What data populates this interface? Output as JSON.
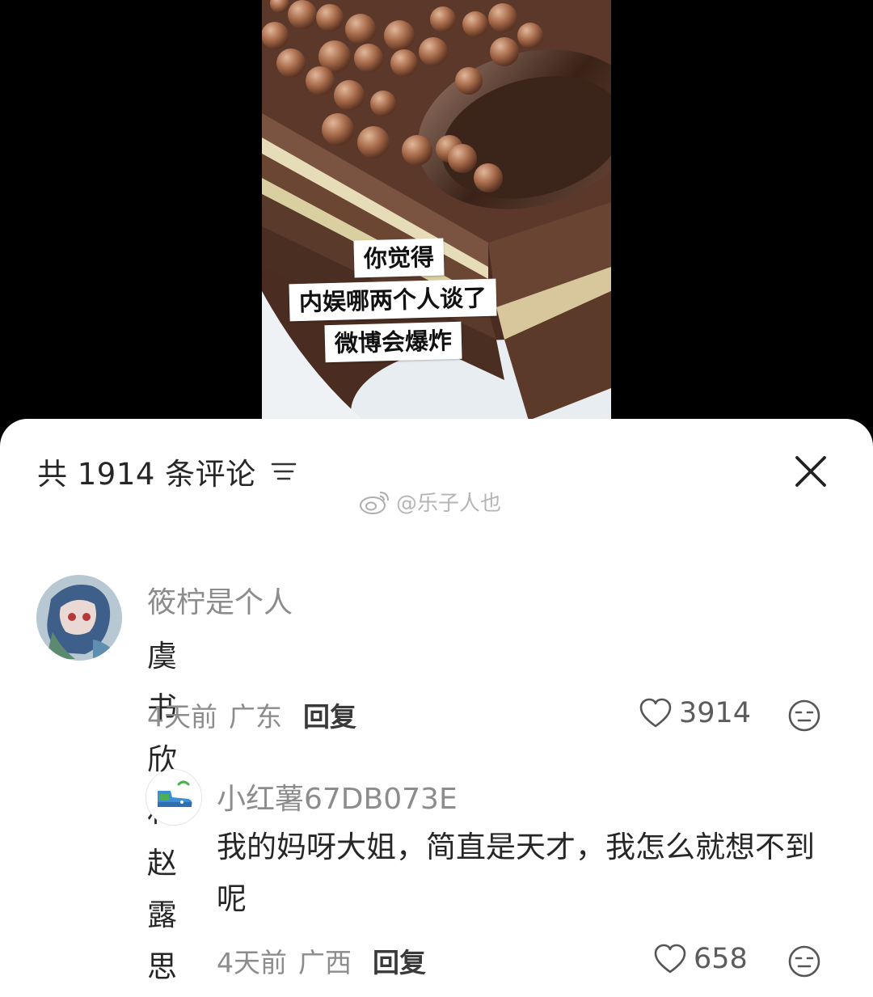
{
  "video": {
    "caption_lines": [
      "你觉得",
      "内娱哪两个人谈了",
      "微博会爆炸"
    ]
  },
  "sheet": {
    "comment_count_text": "共 1914 条评论",
    "sort_icon": "sort-lines-icon",
    "close_icon": "close-icon"
  },
  "watermark": {
    "icon": "weibo-logo-icon",
    "text": "@乐子人也"
  },
  "comments": [
    {
      "author": "筱柠是个人",
      "content": "虞书欣和赵露思",
      "time": "4天前",
      "location": "广东",
      "reply_label": "回复",
      "likes": "3914",
      "like_icon": "heart-outline-icon",
      "emoji_icon": "expressionless-face-icon"
    },
    {
      "author": "小红薯67DB073E",
      "content": "我的妈呀大姐，简直是天才，我怎么就想不到呢",
      "time": "4天前",
      "location": "广西",
      "reply_label": "回复",
      "likes": "658",
      "like_icon": "heart-outline-icon",
      "emoji_icon": "expressionless-face-icon"
    }
  ]
}
